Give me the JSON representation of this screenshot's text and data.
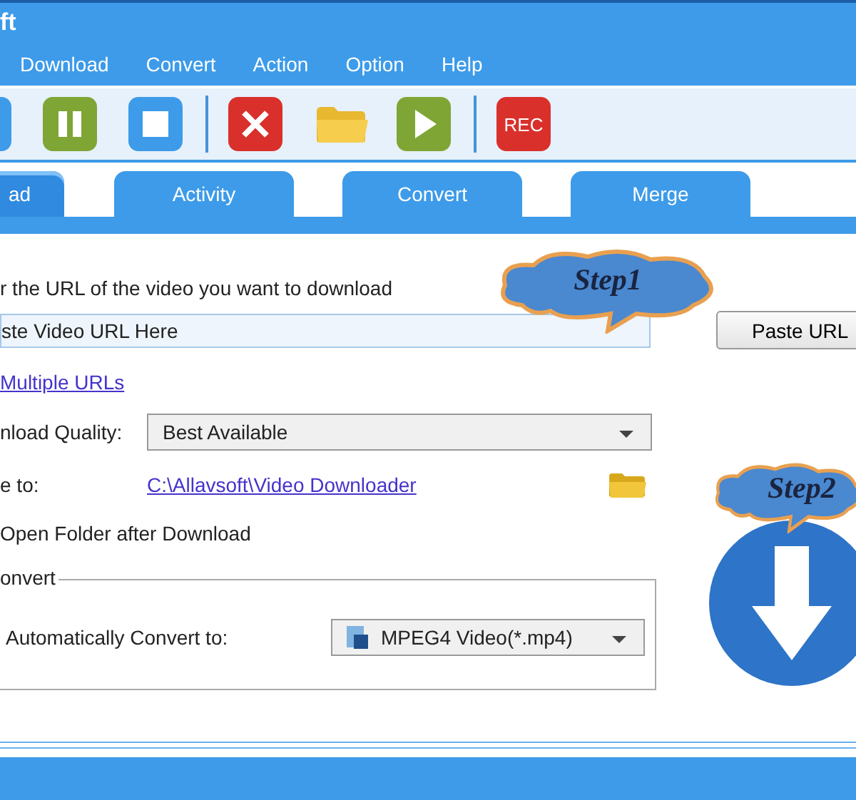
{
  "window": {
    "title": "ft"
  },
  "menu": [
    "Download",
    "Convert",
    "Action",
    "Option",
    "Help"
  ],
  "toolbar": [
    {
      "kind": "start"
    },
    {
      "kind": "pause"
    },
    {
      "kind": "stop"
    },
    {
      "kind": "separator"
    },
    {
      "kind": "delete"
    },
    {
      "kind": "folder"
    },
    {
      "kind": "play"
    },
    {
      "kind": "separator"
    },
    {
      "kind": "rec",
      "label": "REC"
    }
  ],
  "tabs": [
    {
      "label": "ad",
      "selected": true
    },
    {
      "label": "Activity",
      "selected": false
    },
    {
      "label": "Convert",
      "selected": false
    },
    {
      "label": "Merge",
      "selected": false
    }
  ],
  "download": {
    "prompt": "r the URL of the video you want to download",
    "url_field": {
      "value": "ste Video URL Here"
    },
    "paste_button": "Paste URL",
    "multiple_link": "Multiple URLs",
    "quality_label": "nload Quality:",
    "quality_value": "Best Available",
    "save_label": "e to:",
    "save_path": "C:\\Allavsoft\\Video Downloader",
    "open_folder_label": "Open Folder after Download"
  },
  "convert": {
    "legend": "onvert",
    "label": "Automatically Convert to:",
    "format": "MPEG4 Video(*.mp4)"
  },
  "callouts": [
    "Step1",
    "Step2"
  ]
}
